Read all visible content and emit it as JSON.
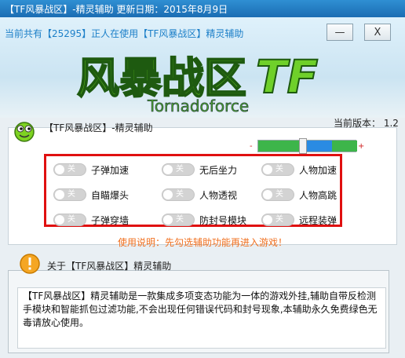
{
  "window": {
    "title": "【TF风暴战区】-精灵辅助    更新日期：2015年8月9日",
    "minimize_label": "—",
    "close_label": "X"
  },
  "header": {
    "online_text": "当前共有【25295】正人在使用【TF风暴战区】精灵辅助",
    "logo_text": "风暴战区",
    "logo_mark": "TF",
    "logo_subtitle": "Tornadoforce"
  },
  "section": {
    "title": "【TF风暴战区】-精灵辅助",
    "version_text": "当前版本： 1.2",
    "opacity_minus": "-",
    "opacity_plus": "+",
    "opacity_value": 0.45
  },
  "features": [
    {
      "toggle": "关",
      "label": "子弹加速"
    },
    {
      "toggle": "关",
      "label": "无后坐力"
    },
    {
      "toggle": "关",
      "label": "人物加速"
    },
    {
      "toggle": "关",
      "label": "自瞄爆头"
    },
    {
      "toggle": "关",
      "label": "人物透视"
    },
    {
      "toggle": "关",
      "label": "人物高跳"
    },
    {
      "toggle": "关",
      "label": "子弹穿墙"
    },
    {
      "toggle": "关",
      "label": "防封号模块"
    },
    {
      "toggle": "关",
      "label": "远程装弹"
    }
  ],
  "usage_text": "使用说明：先勾选辅助功能再进入游戏！",
  "about": {
    "title": "关于【TF风暴战区】精灵辅助",
    "body": "【TF风暴战区】精灵辅助是一款集成多项变态功能为一体的游戏外挂,辅助自带反检测手模块和智能抓包过滤功能,不会出现任何错误代码和封号现象,本辅助永久免费绿色无毒请放心使用。"
  },
  "colors": {
    "title_bar": "#1b6db3",
    "accent_blue": "#1c7fc8",
    "highlight_red": "#e01010",
    "usage_orange": "#f07020",
    "logo_green": "#5ec21a"
  }
}
